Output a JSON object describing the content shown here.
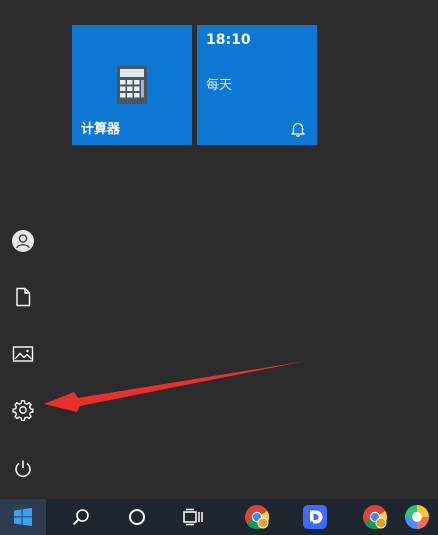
{
  "tiles": {
    "calculator": {
      "label": "计算器",
      "icon": "calculator-icon"
    },
    "alarm": {
      "time": "18:10",
      "repeat": "每天",
      "icon": "bell-icon"
    }
  },
  "rail": [
    {
      "name": "user",
      "icon": "user-avatar-icon"
    },
    {
      "name": "documents",
      "icon": "document-icon"
    },
    {
      "name": "pictures",
      "icon": "picture-icon"
    },
    {
      "name": "settings",
      "icon": "gear-icon"
    },
    {
      "name": "power",
      "icon": "power-icon"
    }
  ],
  "taskbar": [
    {
      "name": "start",
      "icon": "windows-logo-icon"
    },
    {
      "name": "search",
      "icon": "search-icon"
    },
    {
      "name": "cortana",
      "icon": "cortana-circle-icon"
    },
    {
      "name": "task-view",
      "icon": "task-view-icon"
    },
    {
      "name": "chrome",
      "icon": "chrome-icon"
    },
    {
      "name": "app-blue-d",
      "icon": "blue-d-app-icon"
    },
    {
      "name": "chrome-2",
      "icon": "chrome-icon"
    },
    {
      "name": "app-colorful",
      "icon": "colorful-app-icon"
    }
  ],
  "colors": {
    "tile": "#0c78d4",
    "menu_bg": "#2c2c2c",
    "taskbar_bg": "#1f2630",
    "annotation_arrow": "#e8302e"
  }
}
